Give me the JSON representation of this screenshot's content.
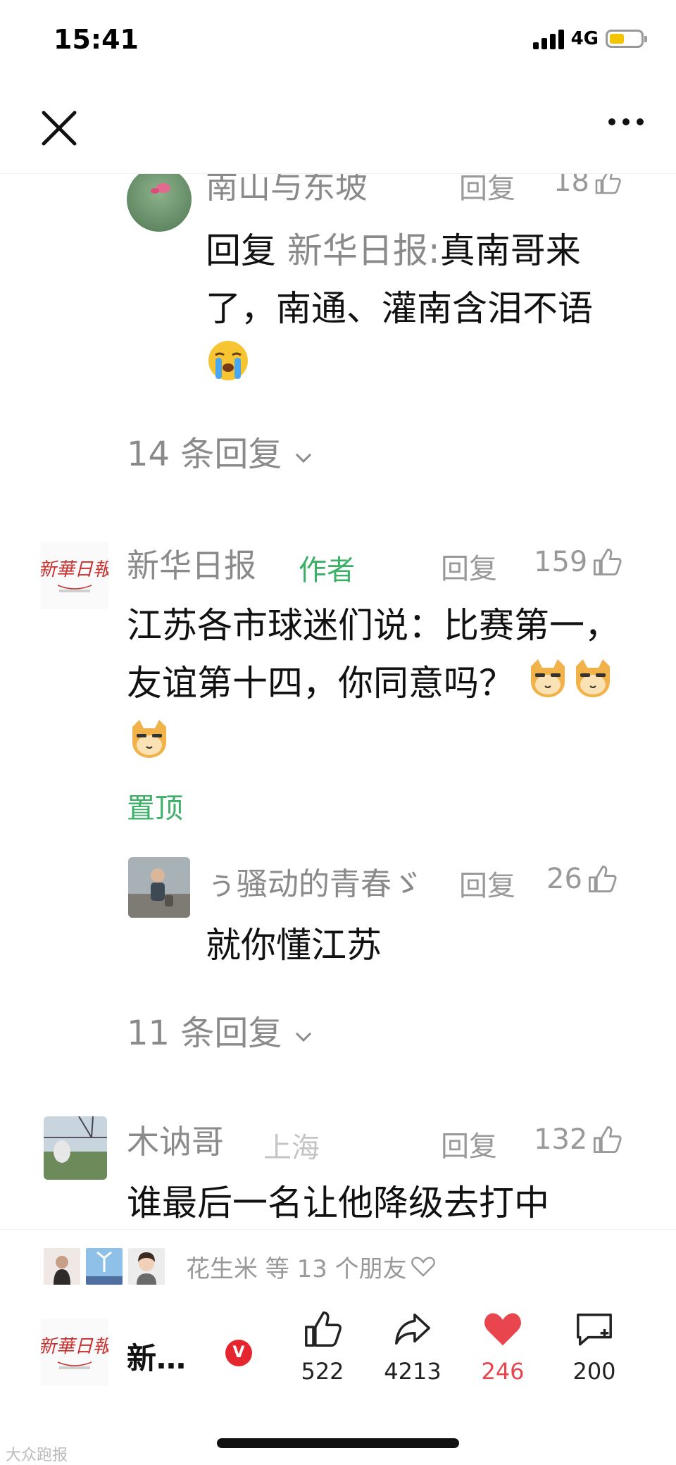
{
  "status_bar": {
    "time": "15:41",
    "network": "4G",
    "battery_level": 0.45
  },
  "comments": [
    {
      "user": "南山与东坡",
      "reply_label": "回复",
      "likes": "18",
      "text_prefix": "回复",
      "text_mention": "新华日报:",
      "text": "真南哥来了，南通、灌南含泪不语",
      "emoji": "crying-face",
      "more_replies": "14 条回复"
    },
    {
      "user": "新华日报",
      "badge": "作者",
      "reply_label": "回复",
      "likes": "159",
      "text": "江苏各市球迷们说：比赛第一，友谊第十四，你同意吗？",
      "emoji": "doge-face",
      "pinned": "置顶",
      "sub_reply": {
        "user": "ぅ骚动的青春ゞ",
        "reply_label": "回复",
        "likes": "26",
        "text": "就你懂江苏"
      },
      "more_replies": "11 条回复"
    },
    {
      "user": "木讷哥",
      "location": "上海",
      "reply_label": "回复",
      "likes": "132",
      "text": "谁最后一名让他降级去打中"
    }
  ],
  "bottom_bar": {
    "friends_text": "花生米 等 13 个朋友",
    "account_name": "新…",
    "verified_badge": "V",
    "actions": [
      {
        "icon": "thumbs-up-icon",
        "count": "522"
      },
      {
        "icon": "share-icon",
        "count": "4213"
      },
      {
        "icon": "heart-icon",
        "count": "246",
        "color": "#e8454e"
      },
      {
        "icon": "comment-add-icon",
        "count": "200"
      }
    ]
  },
  "watermark": "大众跑报",
  "colors": {
    "green": "#3bb067",
    "grey_text": "#8a8a8a",
    "heart_red": "#e8454e",
    "verified_red": "#e5262f"
  }
}
